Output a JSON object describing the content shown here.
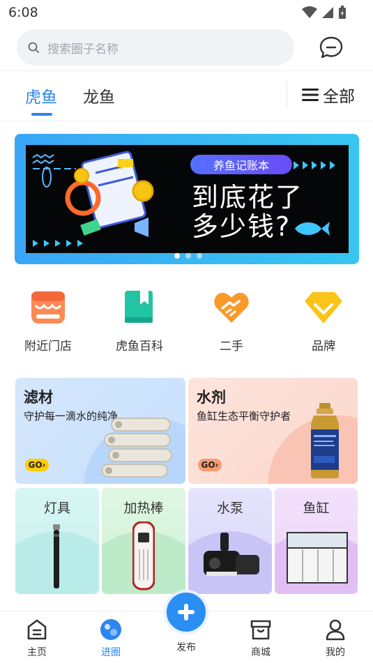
{
  "status_bar": {
    "time": "6:08"
  },
  "search": {
    "placeholder": "搜索圈子名称"
  },
  "tabs": {
    "items": [
      {
        "label": "虎鱼"
      },
      {
        "label": "龙鱼"
      }
    ],
    "all_label": "全部"
  },
  "banner": {
    "pill": "养鱼记账本",
    "headline_1": "到底花了",
    "headline_2": "多少钱?",
    "page_count": 3,
    "active_page": 1
  },
  "quick_entries": [
    {
      "label": "附近门店",
      "icon": "store-icon"
    },
    {
      "label": "虎鱼百科",
      "icon": "book-icon"
    },
    {
      "label": "二手",
      "icon": "handshake-icon"
    },
    {
      "label": "品牌",
      "icon": "diamond-icon"
    }
  ],
  "categories": {
    "filter": {
      "title": "滤材",
      "subtitle": "守护每一滴水的纯净",
      "go": "GO"
    },
    "chemical": {
      "title": "水剂",
      "subtitle": "鱼缸生态平衡守护者",
      "go": "GO"
    },
    "small": [
      {
        "title": "灯具"
      },
      {
        "title": "加热棒"
      },
      {
        "title": "水泵"
      },
      {
        "title": "鱼缸"
      }
    ]
  },
  "bottom_nav": {
    "home": "主页",
    "circle": "进圈",
    "publish": "发布",
    "mall": "商城",
    "me": "我的"
  },
  "colors": {
    "accent": "#2b86ef"
  }
}
